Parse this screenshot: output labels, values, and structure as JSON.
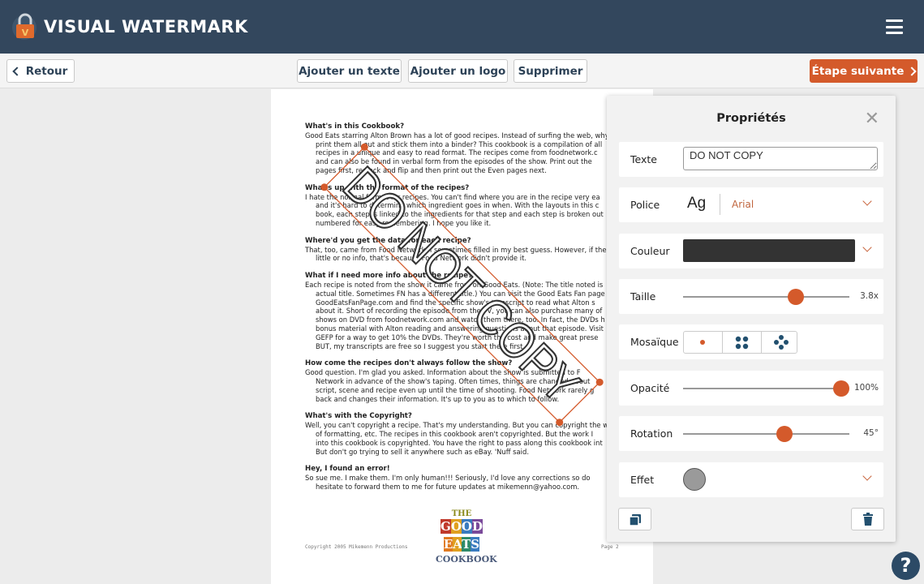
{
  "app": {
    "title": "VISUAL WATERMARK",
    "logo_letter": "V"
  },
  "toolbar": {
    "back_label": "Retour",
    "add_text_label": "Ajouter un texte",
    "add_logo_label": "Ajouter un logo",
    "delete_label": "Supprimer",
    "next_label": "Étape suivante"
  },
  "document": {
    "sections": [
      {
        "heading": "What's in this Cookbook?",
        "lines": [
          "Good Eats starring Alton Brown has a lot of good recipes. Instead of surfing the web, why",
          "print them all out and stick them into a binder? This cookbook is a compilation of all",
          "recipes in a unique and easy to read format. The recipes come from foodnetwork.c",
          "and can also be found in verbal form from the episodes of the show. Print out the",
          "pages first, restack and flip and then print out the Even pages next."
        ]
      },
      {
        "heading": "What's up with the format of the recipes?",
        "lines": [
          "I hate the normal format for recipes. You can't find where you are in the recipe very ea",
          "and it's hard to determine which ingredient goes in when. With the layouts in this c",
          "book, each step is linked to the ingredients for that step and each step is broken out",
          "numbered for easy remembering. I hope you like it."
        ]
      },
      {
        "heading": "Where'd you get the data for each recipe?",
        "lines": [
          "That, too, came from Food Network. I sometimes filled in my best guess. However, if ther",
          "little or no info, that's because Food Network didn't provide it."
        ]
      },
      {
        "heading": "What if I need more info about the recipe?",
        "lines": [
          "Each recipe is noted from the show it came from on Good Eats. (Note: The title noted is",
          "actual title. Sometimes FN has a different title.) You can visit the Good Eats Fan page",
          "GoodEatsFanPage.com and find the specific show's transcript to read what Alton s",
          "about it. Short of recording the episode from the TV, you can also purchase many of",
          "shows on DVD from foodnetwork.com and watch them there, too. In fact, the DVDs h",
          "bonus material with Alton reading and answering questions about that episode. Visit",
          "GEFP for a way to get 10% the DVDs. They're worth the cost and make great prese",
          "BUT, my transcripts are free so I suggest you start there first."
        ]
      },
      {
        "heading": "How come the recipes don't always follow the show?",
        "lines": [
          "Good question. I'm glad you asked. Information about the show is submitted to F",
          "Network in advance of the show's taping. Often times, things are changed about",
          "script, scene and recipe even up until the time of shooting. Food Network rarely g",
          "back and changes their information. It's up to you as to which to follow."
        ]
      },
      {
        "heading": "What's with the Copyright?",
        "lines": [
          "Well, you can't copyright a recipe. That's my understanding. But you can copyright the w",
          "of formatting, etc. The recipes in this cookbook aren't copyrighted. But the work I",
          "into this cookbook is copyrighted. You have the right to pass along this cookbook int",
          "But don't go trying to sell it anywhere such as eBay. 'Nuff said."
        ]
      },
      {
        "heading": "Hey, I found an error!",
        "lines": [
          "So sue me. I make them. I'm only human!!! Seriously, I'd love any corrections so do",
          "hesitate to forward them to me for future updates at mikemenn@yahoo.com."
        ]
      }
    ],
    "footer_left": "Copyright 2005 Mikemenn Productions",
    "footer_right": "Page 2",
    "logo": {
      "the": "THE",
      "good": "GOOD",
      "eats": "EATS",
      "cookbook": "COOKBOOK"
    }
  },
  "watermark": {
    "text": "DO NOT COPY",
    "color": "#333333",
    "rotation_deg": 45,
    "selection_color": "#d45a2b"
  },
  "properties": {
    "title": "Propriétés",
    "text_label": "Texte",
    "text_value": "DO NOT COPY",
    "font_label": "Police",
    "font_preview": "Ag",
    "font_value": "Arial",
    "color_label": "Couleur",
    "color_value": "#333333",
    "size_label": "Taille",
    "size_value": "3.8x",
    "size_fraction": 0.68,
    "mosaic_label": "Mosaïque",
    "mosaic_options": [
      "single-dot-icon",
      "four-dots-grid-icon",
      "five-dots-icon"
    ],
    "mosaic_selected": 0,
    "opacity_label": "Opacité",
    "opacity_value": "100%",
    "opacity_fraction": 1.0,
    "rotation_label": "Rotation",
    "rotation_value": "45°",
    "rotation_fraction": 0.61,
    "effect_label": "Effet"
  },
  "colors": {
    "header": "#33475d",
    "accent": "#d45a2b",
    "icon": "#22506f"
  },
  "help_label": "?"
}
